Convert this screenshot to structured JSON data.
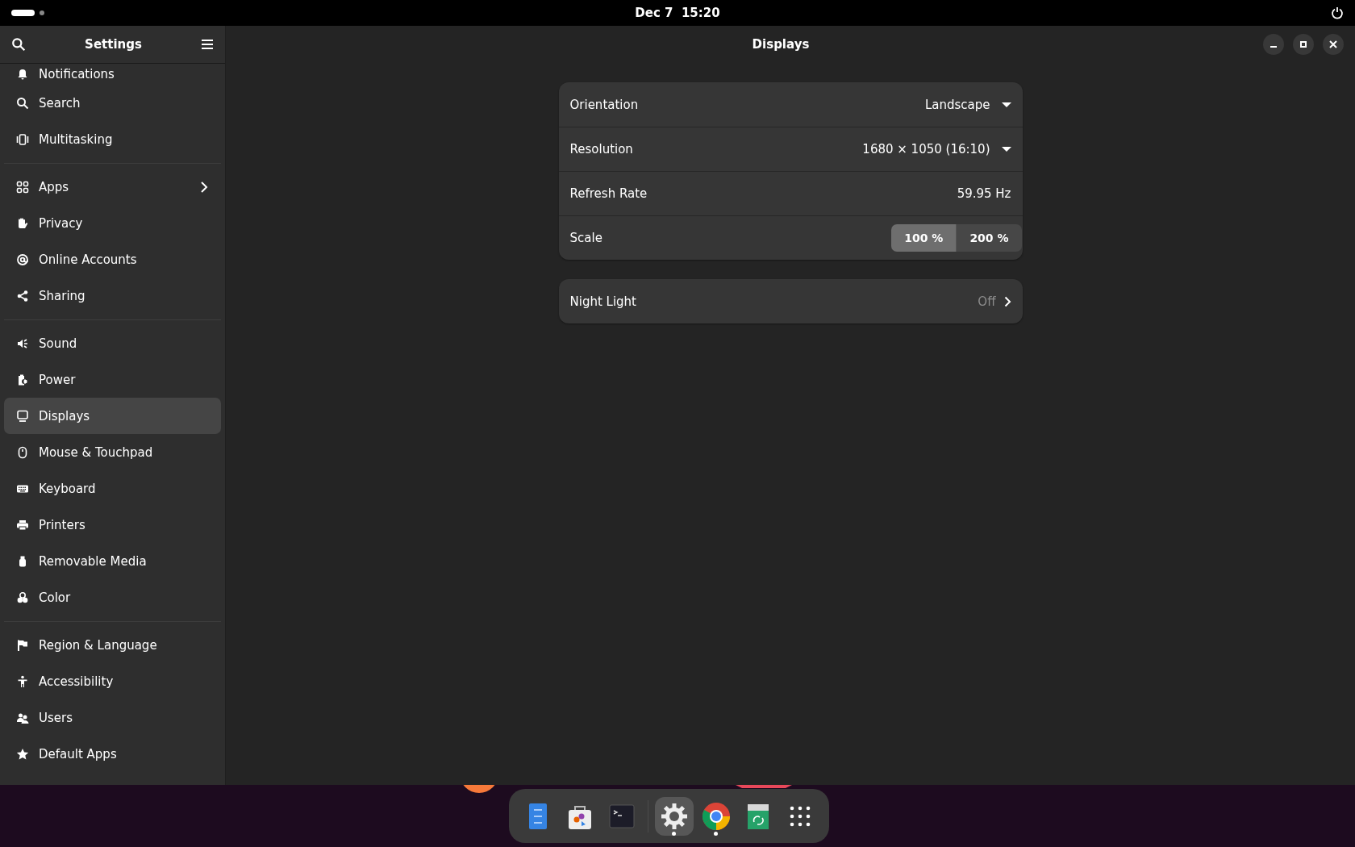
{
  "top_bar": {
    "workspaces": [
      {
        "selected": true
      },
      {
        "selected": false
      }
    ],
    "clock": "Dec 7  15:20"
  },
  "sidebar": {
    "title": "Settings",
    "groups": [
      [
        {
          "label": "Notifications",
          "selected": false,
          "expandable": false
        },
        {
          "label": "Search",
          "selected": false,
          "expandable": false
        },
        {
          "label": "Multitasking",
          "selected": false,
          "expandable": false
        }
      ],
      [
        {
          "label": "Apps",
          "selected": false,
          "expandable": true
        },
        {
          "label": "Privacy",
          "selected": false,
          "expandable": false
        },
        {
          "label": "Online Accounts",
          "selected": false,
          "expandable": false
        },
        {
          "label": "Sharing",
          "selected": false,
          "expandable": false
        }
      ],
      [
        {
          "label": "Sound",
          "selected": false,
          "expandable": false
        },
        {
          "label": "Power",
          "selected": false,
          "expandable": false
        },
        {
          "label": "Displays",
          "selected": true,
          "expandable": false
        },
        {
          "label": "Mouse & Touchpad",
          "selected": false,
          "expandable": false
        },
        {
          "label": "Keyboard",
          "selected": false,
          "expandable": false
        },
        {
          "label": "Printers",
          "selected": false,
          "expandable": false
        },
        {
          "label": "Removable Media",
          "selected": false,
          "expandable": false
        },
        {
          "label": "Color",
          "selected": false,
          "expandable": false
        }
      ],
      [
        {
          "label": "Region & Language",
          "selected": false,
          "expandable": false
        },
        {
          "label": "Accessibility",
          "selected": false,
          "expandable": false
        },
        {
          "label": "Users",
          "selected": false,
          "expandable": false
        },
        {
          "label": "Default Apps",
          "selected": false,
          "expandable": false
        }
      ]
    ]
  },
  "page": {
    "title": "Displays",
    "cards": [
      [
        {
          "kind": "dropdown",
          "label": "Orientation",
          "value": "Landscape"
        },
        {
          "kind": "dropdown",
          "label": "Resolution",
          "value": "1680 × 1050 (16:10)"
        },
        {
          "kind": "value",
          "label": "Refresh Rate",
          "value": "59.95 Hz"
        },
        {
          "kind": "toggle",
          "label": "Scale",
          "options": [
            {
              "label": "100 %",
              "selected": true
            },
            {
              "label": "200 %",
              "selected": false
            }
          ]
        }
      ],
      [
        {
          "kind": "link",
          "label": "Night Light",
          "value": "Off"
        }
      ]
    ]
  },
  "dock": {
    "items": [
      {
        "selected": false,
        "running": false
      },
      {
        "selected": false,
        "running": false
      },
      {
        "selected": false,
        "running": false
      },
      {
        "selected": true,
        "running": true
      },
      {
        "selected": false,
        "running": true
      },
      {
        "selected": false,
        "running": false
      },
      {
        "selected": false,
        "running": false
      }
    ]
  }
}
